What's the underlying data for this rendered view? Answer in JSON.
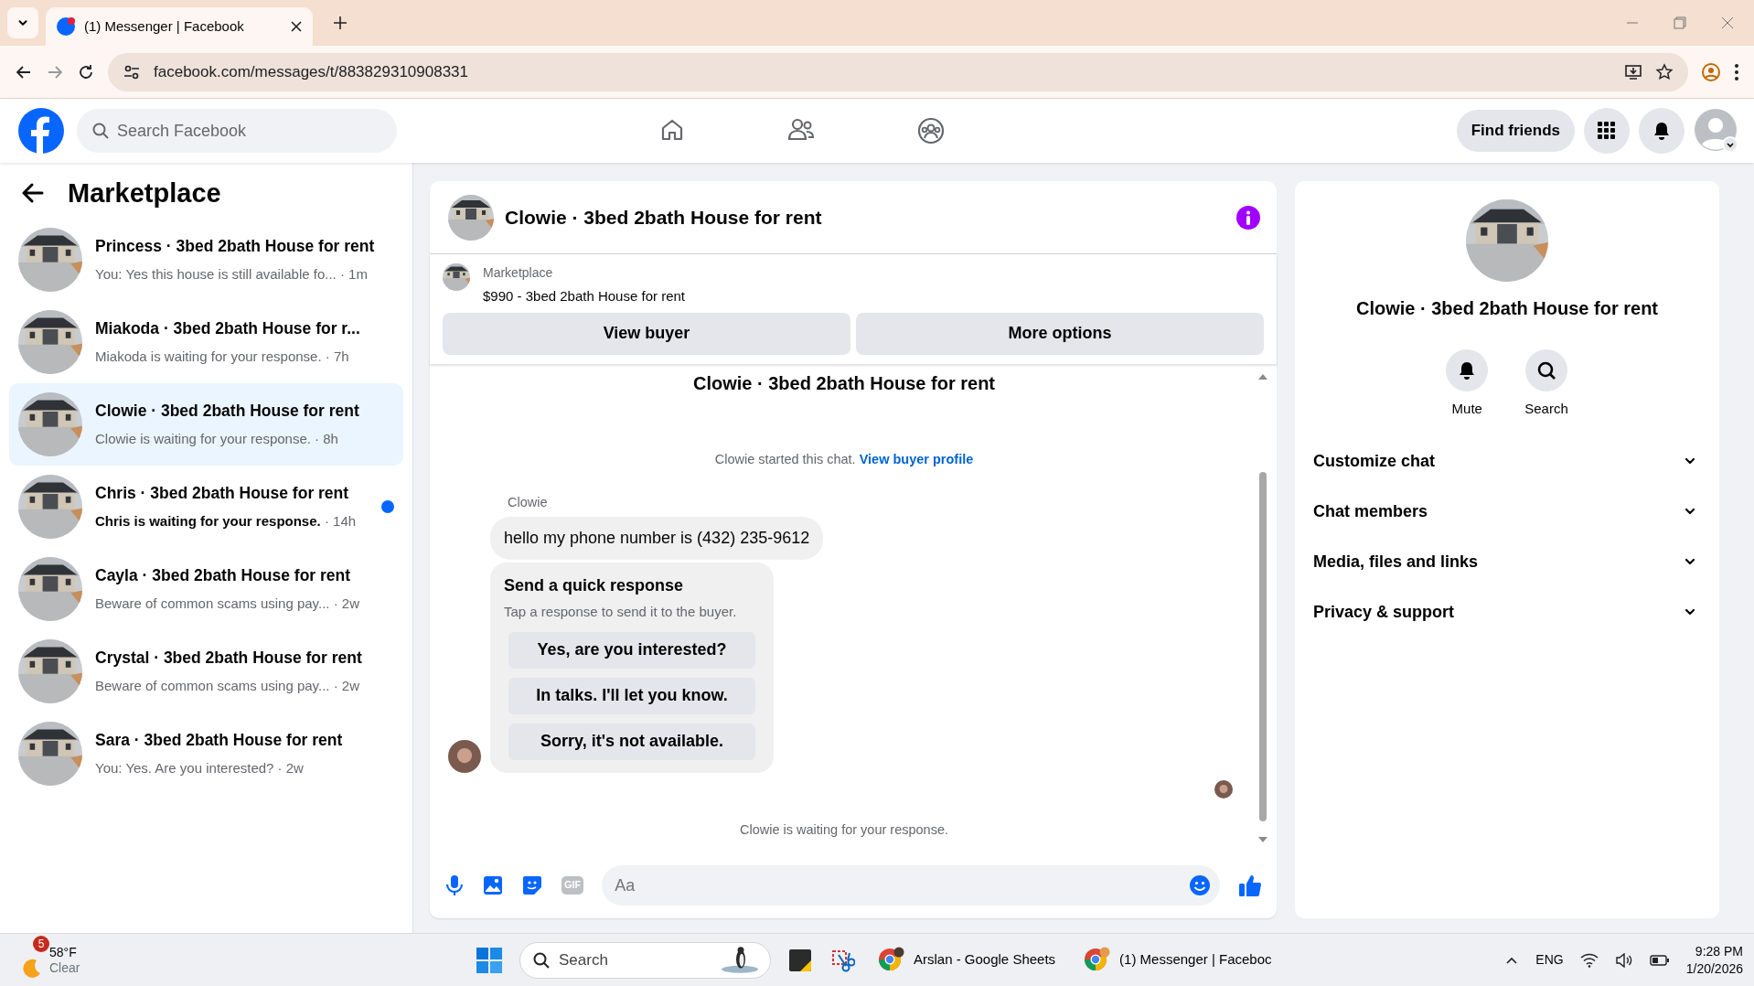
{
  "browser": {
    "tab_title": "(1) Messenger | Facebook",
    "url": "facebook.com/messages/t/883829310908331"
  },
  "header": {
    "search_placeholder": "Search Facebook",
    "find_friends": "Find friends"
  },
  "sidebar": {
    "title": "Marketplace",
    "conversations": [
      {
        "name": "Princess · 3bed 2bath House for rent",
        "preview": "You: Yes this house is still available fo...",
        "time": "· 1m",
        "selected": false,
        "unread": false
      },
      {
        "name": "Miakoda · 3bed 2bath House for r...",
        "preview": "Miakoda is waiting for your response.",
        "time": "· 7h",
        "selected": false,
        "unread": false
      },
      {
        "name": "Clowie · 3bed 2bath House for rent",
        "preview": "Clowie is waiting for your response.",
        "time": "· 8h",
        "selected": true,
        "unread": false
      },
      {
        "name": "Chris · 3bed 2bath House for rent",
        "preview": "Chris is waiting for your response.",
        "time": "· 14h",
        "selected": false,
        "unread": true
      },
      {
        "name": "Cayla · 3bed 2bath House for rent",
        "preview": "Beware of common scams using pay...",
        "time": "· 2w",
        "selected": false,
        "unread": false
      },
      {
        "name": "Crystal · 3bed 2bath House for rent",
        "preview": "Beware of common scams using pay...",
        "time": "· 2w",
        "selected": false,
        "unread": false
      },
      {
        "name": "Sara · 3bed 2bath House for rent",
        "preview": "You: Yes. Are you interested?",
        "time": "· 2w",
        "selected": false,
        "unread": false
      }
    ]
  },
  "chat": {
    "title": "Clowie · 3bed 2bath House for rent",
    "listing": {
      "label": "Marketplace",
      "price_title": "$990 - 3bed 2bath House for rent"
    },
    "buttons": [
      "View buyer",
      "More options"
    ],
    "cut_title": "Clowie · 3bed 2bath House for rent",
    "started_text": "Clowie started this chat.",
    "started_link": "View buyer profile",
    "sender": "Clowie",
    "message": "hello my phone number is (432) 235-9612",
    "quick_response": {
      "title": "Send a quick response",
      "hint": "Tap a response to send it to the buyer.",
      "options": [
        "Yes, are you interested?",
        "In talks. I'll let you know.",
        "Sorry, it's not available."
      ]
    },
    "waiting": "Clowie is waiting for your response.",
    "composer": {
      "gif_label": "GIF",
      "placeholder": "Aa"
    }
  },
  "details": {
    "title": "Clowie · 3bed 2bath House for rent",
    "actions": [
      "Mute",
      "Search"
    ],
    "sections": [
      {
        "label": "Customize chat",
        "expanded": false
      },
      {
        "label": "Chat members",
        "expanded": false
      },
      {
        "label": "Media, files and links",
        "expanded": false
      },
      {
        "label": "Privacy & support",
        "expanded": false
      }
    ]
  },
  "taskbar": {
    "weather_badge": "5",
    "temperature": "58°F",
    "condition": "Clear",
    "search_placeholder": "Search",
    "apps": [
      "Arslan - Google Sheets",
      "(1) Messenger | Faceboc"
    ],
    "language": "ENG",
    "time": "9:28 PM",
    "date": "1/20/2026"
  }
}
